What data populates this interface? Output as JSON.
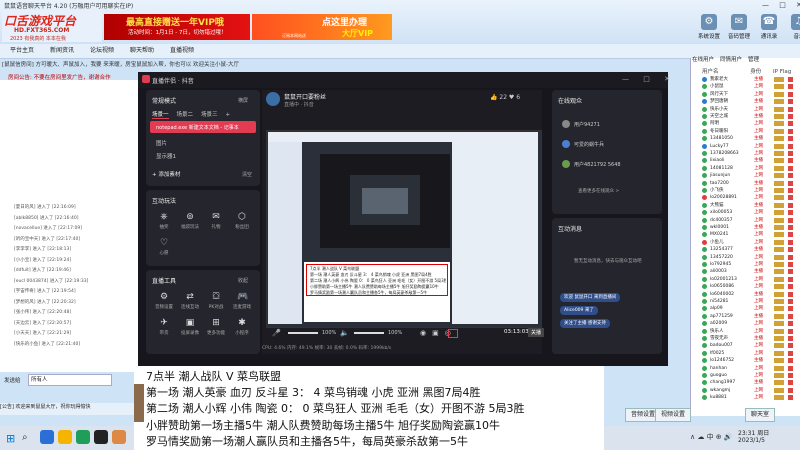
{
  "app": {
    "title": "鼠鼠语音聊天平台 4.20 (万融用户可用聊实在IP)",
    "logo_main": "口舌游戏平台",
    "logo_sub": "HD.FXT365.COM",
    "logo_slogan": "2023 有我真的 本本在我"
  },
  "ads": {
    "ad1_title": "最高直接赠送一年VIP哦",
    "ad1_subtitle": "活动时间：1月1日 - 7日，切勿错过哦！",
    "ad2_title": "点这里办理",
    "ad2_badge": "大厅VIP",
    "ad2_small": "订阅本网站送"
  },
  "top_tools": [
    {
      "label": "系统设置",
      "icon": "⚙"
    },
    {
      "label": "音码管理",
      "icon": "✉"
    },
    {
      "label": "通讯录",
      "icon": "☎"
    },
    {
      "label": "音乐",
      "icon": "♫"
    },
    {
      "label": "退出平台",
      "icon": "⏻"
    }
  ],
  "window_controls": "— □ ✕",
  "tabs": [
    "平台主页",
    "新闻资讯",
    "论坛视频",
    "聊天帮助",
    "直播视频"
  ],
  "right_tabs": [
    "在线用户",
    "同情用户",
    "管理"
  ],
  "notice": "[鼠鼠信房间] 方可暖大、声鼠加入，我要 来来暖，房宝鼠鼠加入帮，你也可以 欢迎关注小鼠-大厅",
  "scroll_notice": "房间公告: 不要在房间里发广告，谢谢合作",
  "chat_lines": [
    "[夏日的风] 进入了 [22:16:09]",
    "[ablk8850] 进入了 [22:16:40]",
    "[novacellue] 进入了 [22:17:09]",
    "[听的宝中天] 进入了 [22:17:40]",
    "[李李李] 进入了 [22:18:13]",
    "[小小宝] 进入了 [22:19:24]",
    "[ddfuit] 进入了 [22:19:46]",
    "[eucl 0043874] 进入了 [22:19:33]",
    "[宇宙传奇] 进入了 [22:19:54]",
    "[梦想的风] 进入了 [22:20:32]",
    "[张小伟] 进入了 [22:20:48]",
    "[天边云] 进入了 [22:20:57]",
    "[小天天] 进入了 [22:21:29]",
    "[快乐的小鱼] 进入了 [22:21:40]"
  ],
  "input": {
    "label": "发送给",
    "value": "所有人"
  },
  "bottom_bar": "[公告] 欢迎来到鼠鼠大厅，祝你玩得愉快",
  "userlist": {
    "header_name": "用户名",
    "header_role": "身份",
    "header_flag": "IP Flag",
    "users": [
      {
        "name": "我家老大",
        "role": "主播",
        "color": "#2b7bd6"
      },
      {
        "name": "小鼠鼠",
        "role": "上网",
        "color": "#3aa757"
      },
      {
        "name": "风行天下",
        "role": "上网",
        "color": "#3aa757"
      },
      {
        "name": "梦回唐朝",
        "role": "主播",
        "color": "#2b7bd6"
      },
      {
        "name": "快乐小天",
        "role": "上网",
        "color": "#3aa757"
      },
      {
        "name": "天空之城",
        "role": "主播",
        "color": "#3aa757"
      },
      {
        "name": "阿明",
        "role": "上网",
        "color": "#3aa757"
      },
      {
        "name": "冬日暖阳",
        "role": "上网",
        "color": "#3aa757"
      },
      {
        "name": "13481050",
        "role": "主播",
        "color": "#3aa757"
      },
      {
        "name": "Lucky77",
        "role": "上网",
        "color": "#2b7bd6"
      },
      {
        "name": "1378208663",
        "role": "上网",
        "color": "#3aa757"
      },
      {
        "name": "lixiaoli",
        "role": "主播",
        "color": "#3aa757"
      },
      {
        "name": "14081128",
        "role": "上网",
        "color": "#3aa757"
      },
      {
        "name": "jiasunjun",
        "role": "上网",
        "color": "#3aa757"
      },
      {
        "name": "tao7200",
        "role": "主播",
        "color": "#3aa757"
      },
      {
        "name": "小飞侠",
        "role": "上网",
        "color": "#3aa757"
      },
      {
        "name": "lo20028891",
        "role": "上网",
        "color": "#e23c3c"
      },
      {
        "name": "大熊猫",
        "role": "主播",
        "color": "#3aa757"
      },
      {
        "name": "xilo00053",
        "role": "上网",
        "color": "#3aa757"
      },
      {
        "name": "dc400357",
        "role": "上网",
        "color": "#3aa757"
      },
      {
        "name": "wkl0001",
        "role": "主播",
        "color": "#3aa757"
      },
      {
        "name": "MX0241",
        "role": "上网",
        "color": "#3aa757"
      },
      {
        "name": "小鱼儿",
        "role": "上网",
        "color": "#e23c3c"
      },
      {
        "name": "13254377",
        "role": "主播",
        "color": "#3aa757"
      },
      {
        "name": "13457220",
        "role": "上网",
        "color": "#3aa757"
      },
      {
        "name": "lo792945",
        "role": "上网",
        "color": "#3aa757"
      },
      {
        "name": "ali0003",
        "role": "主播",
        "color": "#3aa757"
      },
      {
        "name": "lo02001213",
        "role": "上网",
        "color": "#3aa757"
      },
      {
        "name": "lo0650086",
        "role": "上网",
        "color": "#3aa757"
      },
      {
        "name": "lo6040002",
        "role": "主播",
        "color": "#3aa757"
      },
      {
        "name": "ni54281",
        "role": "上网",
        "color": "#3aa757"
      },
      {
        "name": "alp09",
        "role": "上网",
        "color": "#3aa757"
      },
      {
        "name": "ap771259",
        "role": "主播",
        "color": "#3aa757"
      },
      {
        "name": "a02009",
        "role": "上网",
        "color": "#3aa757"
      },
      {
        "name": "快乐人",
        "role": "上网",
        "color": "#3aa757"
      },
      {
        "name": "雪夜无声",
        "role": "主播",
        "color": "#3aa757"
      },
      {
        "name": "badou007",
        "role": "上网",
        "color": "#3aa757"
      },
      {
        "name": "lf0025",
        "role": "上网",
        "color": "#3aa757"
      },
      {
        "name": "lo1246752",
        "role": "主播",
        "color": "#3aa757"
      },
      {
        "name": "hanhan",
        "role": "上网",
        "color": "#3aa757"
      },
      {
        "name": "guoguo",
        "role": "上网",
        "color": "#3aa757"
      },
      {
        "name": "chang1997",
        "role": "主播",
        "color": "#3aa757"
      },
      {
        "name": "wkangmj",
        "role": "上网",
        "color": "#3aa757"
      },
      {
        "name": "ku8881",
        "role": "上网",
        "color": "#3aa757"
      },
      {
        "name": "abc7213",
        "role": "主播",
        "color": "#3aa757"
      },
      {
        "name": "小猫咪",
        "role": "上网",
        "color": "#3aa757"
      }
    ]
  },
  "bottom_buttons": [
    "音频设置",
    "视频设置",
    "聊天室"
  ],
  "taskbar": {
    "time": "23:31 周日",
    "date": "2023/1/5",
    "tray": "∧ ☁ 中 ⊕ 🔊"
  },
  "obs": {
    "title": "直播伴侣 · 抖音",
    "winctrl": "— □ ✕",
    "mode_label": "常规模式",
    "mode_action": "横屏",
    "scene_tabs": [
      "场景一",
      "场景二",
      "场景三",
      "+"
    ],
    "active_scene": "notepad.exe 新建文本文档 - 记事本",
    "sources": [
      "图片",
      "显示器1"
    ],
    "add_source": "+ 添加素材",
    "add_source_action": "清空",
    "interact_title": "互动玩法",
    "interact_items": [
      "抽奖",
      "福袋玩法",
      "礼物",
      "粉丝团",
      "心愿"
    ],
    "tools_title": "直播工具",
    "tools_action": "收起",
    "tools_items": [
      "音频设置",
      "连线互动",
      "PK对战",
      "连麦游戏",
      "带货",
      "投屏录像",
      "更多功能",
      "小程序"
    ],
    "stream_title": "鼠鼠开口要粉丝",
    "stream_sub": "直播中 · 抖音",
    "likes": "👍 22   ♥ 6",
    "mic_pct": "100%",
    "spk_pct": "100%",
    "time": "03:13:03",
    "end_label": "关播",
    "stats": "CPU: 4.6%   内存: 49.1%   帧率: 30   丢帧: 0.0%   码率: 1999kb/s",
    "online_title": "在线观众",
    "online_users": [
      "用户94271",
      "可爱的蜗牛兵",
      "用户4821792 5648"
    ],
    "online_more": "查看更多在线观众 >",
    "interact_msgs_title": "互动消息",
    "interact_empty": "暂无互动消息，快去与观众互动吧",
    "msg_bubbles": [
      "欢迎 鼠鼠开口 来到直播间",
      "Alice009 来了",
      "关注了主播 感谢支持"
    ]
  },
  "overlay": {
    "lines": [
      "7点半                                  潮人战队 V 菜鸟联盟",
      "第一场    潮人英豪 血刃 反斗星 3：  4 菜鸟销魂 小虎 亚洲        黑图7局4胜",
      "第二场    潮人小辉 小伟 陶瓷 0：  0 菜鸟狂人 亚洲 毛毛（女）开图不游 5局3胜",
      "小胖赞助第一场主播5牛    潮人队费赞助每场主播5牛    旭仔奖励陶瓷赢10牛",
      "罗马情奖励第一场潮人赢队员和主播各5牛，每局英豪杀敌第一5牛"
    ]
  }
}
